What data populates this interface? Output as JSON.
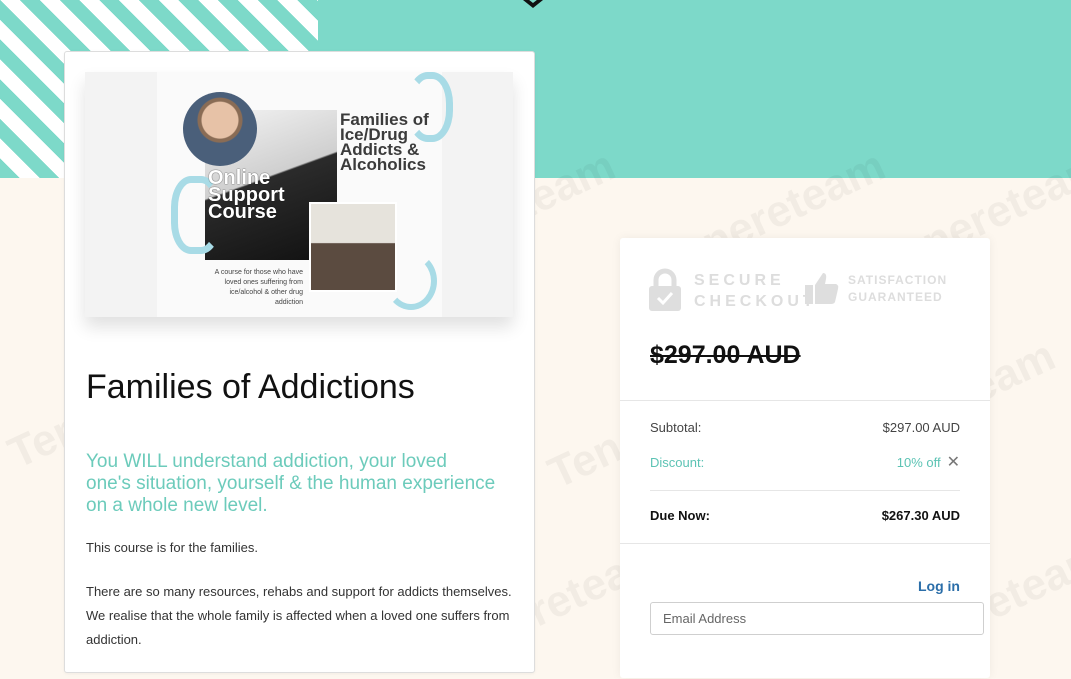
{
  "hero_image": {
    "heading": "Families of Ice/Drug Addicts & Alcoholics",
    "subheading": "Online Support Course",
    "blurb": "A course for those who have loved ones suffering from ice/alcohol & other drug addiction"
  },
  "course": {
    "title": "Families of Addictions",
    "tagline": "You WILL understand addiction, your loved one's situation, yourself & the human experience on a whole new level.",
    "paragraphs": [
      "This course is for the families.",
      "There are so many resources, rehabs and support for addicts themselves. We realise that the whole family is affected when a loved one suffers from addiction."
    ]
  },
  "checkout": {
    "badges": {
      "secure": "SECURE CHECKOUT",
      "satisfaction": "SATISFACTION GUARANTEED"
    },
    "original_price": "$297.00 AUD",
    "subtotal_label": "Subtotal:",
    "subtotal_value": "$297.00 AUD",
    "discount_label": "Discount:",
    "discount_value": "10% off",
    "discount_remove": "✕",
    "due_label": "Due Now:",
    "due_value": "$267.30 AUD",
    "login_label": "Log in",
    "email_placeholder": "Email Address",
    "email_value": ""
  },
  "watermark": "Tenereteam",
  "colors": {
    "accent_teal": "#7dd9c9",
    "tagline_teal": "#6ccbbb",
    "link_blue": "#2b6ea9",
    "page_bg": "#fdf7ef"
  },
  "icons": [
    "logo-icon",
    "lock-icon",
    "thumbs-up-icon",
    "close-icon"
  ]
}
